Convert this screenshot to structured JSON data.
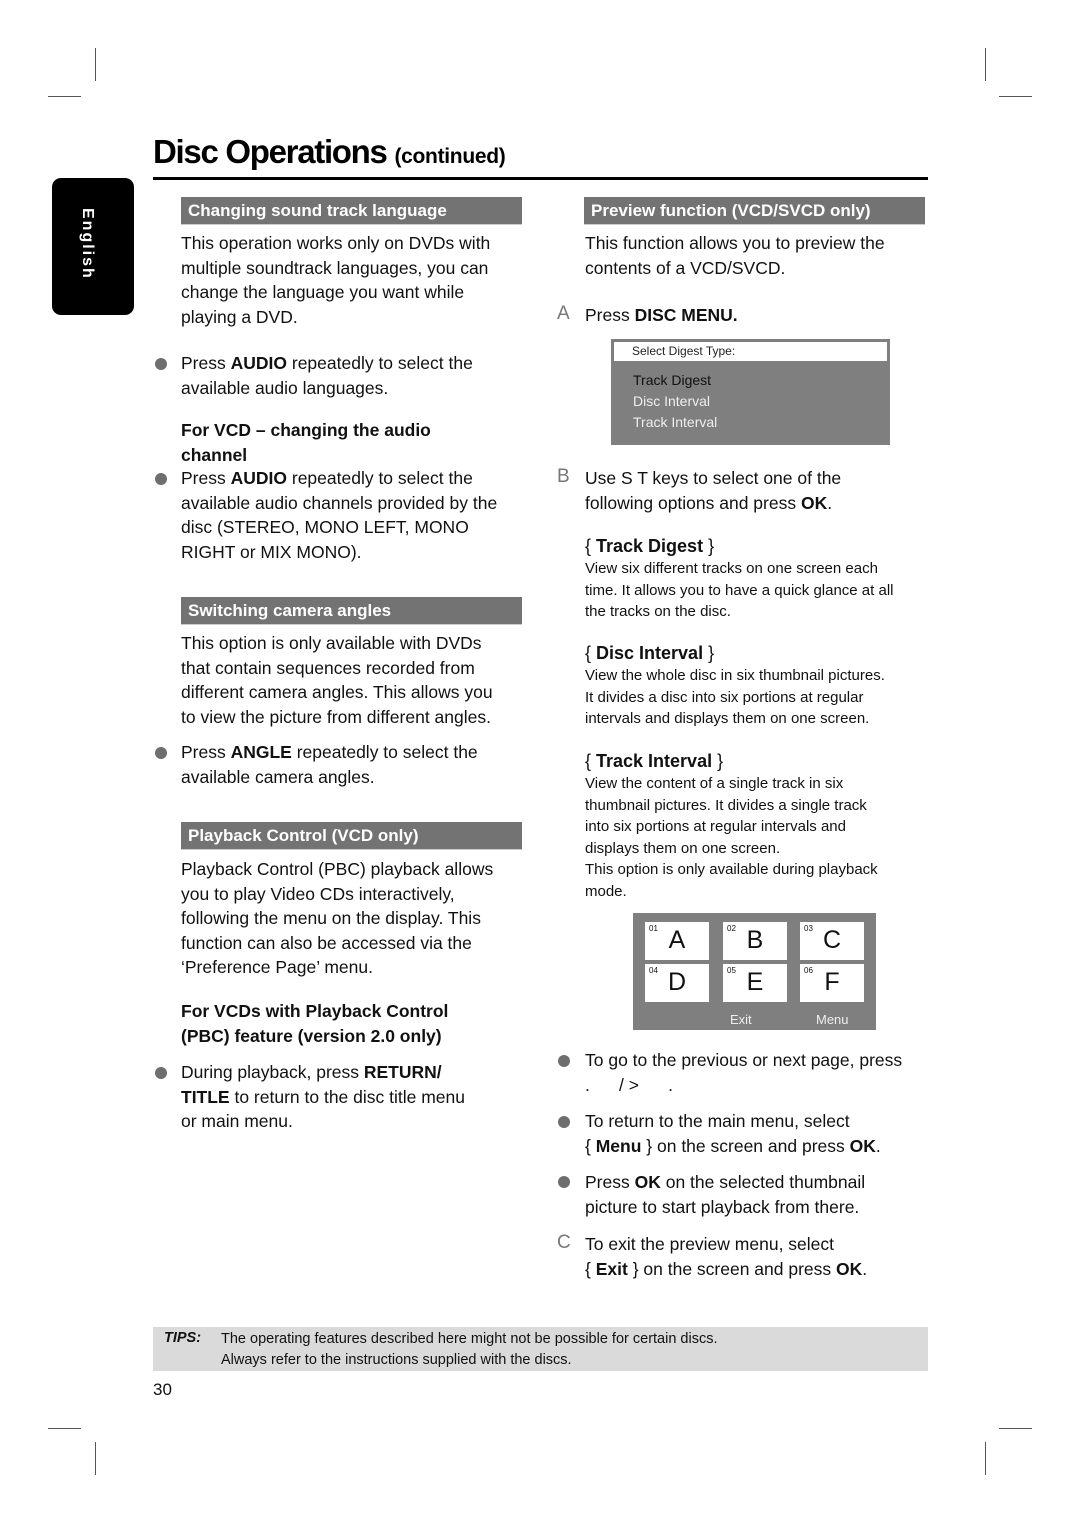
{
  "header": {
    "title": "Disc Operations",
    "title_suffix": "(continued)",
    "language_tab": "English"
  },
  "left": {
    "sound_track": {
      "heading": "Changing sound track language",
      "intro": [
        "This operation works only on DVDs with",
        "multiple soundtrack languages, you can",
        "change the language you want while",
        "playing a DVD."
      ],
      "bullet1": {
        "pre": "Press ",
        "bold": "AUDIO",
        "post": " repeatedly to select the",
        "line2": "available audio languages."
      },
      "vcd_heading": [
        "For VCD – changing the audio",
        "channel"
      ],
      "bullet2": {
        "pre": "Press ",
        "bold": "AUDIO",
        "post": " repeatedly to select the",
        "lines": [
          "available audio channels provided by the",
          "disc (STEREO, MONO LEFT, MONO",
          "RIGHT or MIX MONO)."
        ]
      }
    },
    "camera": {
      "heading": "Switching camera angles",
      "intro": [
        "This option is only available with DVDs",
        "that contain sequences recorded from",
        "different camera angles. This allows you",
        "to view the picture from different angles."
      ],
      "bullet": {
        "pre": "Press ",
        "bold": "ANGLE",
        "post": " repeatedly to select the",
        "line2": "available camera angles."
      }
    },
    "pbc": {
      "heading": "Playback Control (VCD only)",
      "intro": [
        "Playback Control (PBC) playback allows",
        "you to play Video CDs interactively,",
        "following the menu on the display.  This",
        "function can also be accessed via the",
        "‘Preference Page’ menu."
      ],
      "sub_heading": [
        "For VCDs with Playback Control",
        "(PBC) feature (version 2.0 only)"
      ],
      "bullet": {
        "pre": "During playback, press ",
        "bold1": "RETURN/",
        "bold2": "TITLE",
        "post": " to return to the disc title menu",
        "line3": "or main menu."
      }
    }
  },
  "right": {
    "preview": {
      "heading": "Preview function (VCD/SVCD only)",
      "intro": [
        "This function allows you to preview the",
        "contents of a VCD/SVCD."
      ],
      "step_a": {
        "marker": "A",
        "pre": "Press ",
        "bold": "DISC MENU."
      },
      "digest_menu": {
        "title": "Select Digest Type:",
        "items": [
          "Track Digest",
          "Disc Interval",
          "Track Interval"
        ],
        "selected_index": 0
      },
      "step_b": {
        "marker": "B",
        "line1": "Use  S T  keys to select one of the",
        "line2_pre": "following options and press ",
        "line2_bold": "OK",
        "line2_post": "."
      },
      "options": [
        {
          "name": "Track Digest",
          "desc": [
            "View six different tracks on one screen each",
            "time.  It allows you to have a quick glance at all",
            "the tracks on the disc."
          ]
        },
        {
          "name": "Disc Interval",
          "desc": [
            "View the whole disc in six thumbnail pictures.",
            "It divides a disc into six portions at regular",
            "intervals and displays them on one screen."
          ]
        },
        {
          "name": "Track Interval",
          "desc": [
            "View the content of a single track in six",
            "thumbnail pictures.  It divides a single track",
            "into six portions at regular intervals and",
            "displays them on one screen.",
            "This option is only available during playback",
            "mode."
          ]
        }
      ],
      "thumbnails": {
        "items": [
          {
            "num": "01",
            "letter": "A"
          },
          {
            "num": "02",
            "letter": "B"
          },
          {
            "num": "03",
            "letter": "C"
          },
          {
            "num": "04",
            "letter": "D"
          },
          {
            "num": "05",
            "letter": "E"
          },
          {
            "num": "06",
            "letter": "F"
          }
        ],
        "exit_label": "Exit",
        "menu_label": "Menu"
      },
      "bullet_page": {
        "line1": "To go to the previous or next page, press",
        "line2": ".      / >      ."
      },
      "bullet_menu": {
        "line1": "To return to the main menu, select",
        "pre": "{ ",
        "bold": "Menu",
        "mid": " } on the screen and press ",
        "bold2": "OK",
        "post": "."
      },
      "bullet_ok": {
        "pre": "Press ",
        "bold": "OK",
        "post": " on the selected thumbnail",
        "line2": "picture to start playback from there."
      },
      "step_c": {
        "marker": "C",
        "line1": "To exit the preview menu, select",
        "pre": "{ ",
        "bold": "Exit",
        "mid": " } on the screen and press ",
        "bold2": "OK",
        "post": "."
      }
    }
  },
  "tips": {
    "label": "TIPS:",
    "lines": [
      "The operating features described here might not be possible for certain discs.",
      "Always refer to the instructions supplied with the discs."
    ]
  },
  "page_number": "30"
}
